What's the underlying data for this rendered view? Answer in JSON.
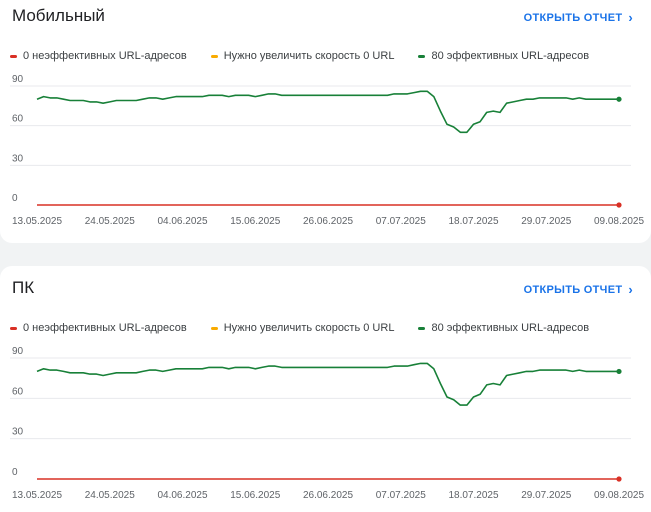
{
  "cards": [
    {
      "title": "Мобильный",
      "open_report": "ОТКРЫТЬ ОТЧЕТ",
      "legend": [
        {
          "label": "0 неэффективных URL-адресов",
          "color": "#d93025"
        },
        {
          "label": "Нужно увеличить скорость 0 URL",
          "color": "#f9ab00"
        },
        {
          "label": "80 эффективных URL-адресов",
          "color": "#188038"
        }
      ]
    },
    {
      "title": "ПК",
      "open_report": "ОТКРЫТЬ ОТЧЕТ",
      "legend": [
        {
          "label": "0 неэффективных URL-адресов",
          "color": "#d93025"
        },
        {
          "label": "Нужно увеличить скорость 0 URL",
          "color": "#f9ab00"
        },
        {
          "label": "80 эффективных URL-адресов",
          "color": "#188038"
        }
      ]
    }
  ],
  "chart_data": [
    {
      "type": "line",
      "title": "Мобильный",
      "xlabel": "",
      "ylabel": "",
      "ylim": [
        0,
        90
      ],
      "yticks": [
        0,
        30,
        60,
        90
      ],
      "x_tick_labels": [
        "13.05.2025",
        "24.05.2025",
        "04.06.2025",
        "15.06.2025",
        "26.06.2025",
        "07.07.2025",
        "18.07.2025",
        "29.07.2025",
        "09.08.2025"
      ],
      "grid": true,
      "series": [
        {
          "name": "0 неэффективных URL-адресов",
          "color": "#d93025",
          "values": [
            0,
            0,
            0,
            0,
            0,
            0,
            0,
            0,
            0,
            0,
            0,
            0,
            0,
            0,
            0,
            0,
            0,
            0,
            0,
            0,
            0,
            0,
            0,
            0,
            0,
            0,
            0,
            0,
            0,
            0,
            0,
            0,
            0,
            0,
            0,
            0,
            0,
            0,
            0,
            0,
            0,
            0,
            0,
            0,
            0,
            0,
            0,
            0,
            0,
            0,
            0,
            0,
            0,
            0,
            0,
            0,
            0,
            0,
            0,
            0,
            0,
            0,
            0,
            0,
            0,
            0,
            0,
            0,
            0,
            0,
            0,
            0,
            0,
            0,
            0,
            0,
            0,
            0,
            0,
            0,
            0,
            0,
            0,
            0,
            0,
            0,
            0,
            0,
            0
          ]
        },
        {
          "name": "80 эффективных URL-адресов",
          "color": "#188038",
          "values": [
            80,
            82,
            81,
            81,
            80,
            79,
            79,
            79,
            78,
            78,
            77,
            78,
            79,
            79,
            79,
            79,
            80,
            81,
            81,
            80,
            81,
            82,
            82,
            82,
            82,
            82,
            83,
            83,
            83,
            82,
            83,
            83,
            83,
            82,
            83,
            84,
            84,
            83,
            83,
            83,
            83,
            83,
            83,
            83,
            83,
            83,
            83,
            83,
            83,
            83,
            83,
            83,
            83,
            83,
            84,
            84,
            84,
            85,
            86,
            86,
            82,
            71,
            61,
            59,
            55,
            55,
            61,
            63,
            70,
            71,
            70,
            77,
            78,
            79,
            80,
            80,
            81,
            81,
            81,
            81,
            81,
            80,
            81,
            80,
            80,
            80,
            80,
            80,
            80
          ]
        }
      ]
    },
    {
      "type": "line",
      "title": "ПК",
      "xlabel": "",
      "ylabel": "",
      "ylim": [
        0,
        90
      ],
      "yticks": [
        0,
        30,
        60,
        90
      ],
      "x_tick_labels": [
        "13.05.2025",
        "24.05.2025",
        "04.06.2025",
        "15.06.2025",
        "26.06.2025",
        "07.07.2025",
        "18.07.2025",
        "29.07.2025",
        "09.08.2025"
      ],
      "grid": true,
      "series": [
        {
          "name": "0 неэффективных URL-адресов",
          "color": "#d93025",
          "values": [
            0,
            0,
            0,
            0,
            0,
            0,
            0,
            0,
            0,
            0,
            0,
            0,
            0,
            0,
            0,
            0,
            0,
            0,
            0,
            0,
            0,
            0,
            0,
            0,
            0,
            0,
            0,
            0,
            0,
            0,
            0,
            0,
            0,
            0,
            0,
            0,
            0,
            0,
            0,
            0,
            0,
            0,
            0,
            0,
            0,
            0,
            0,
            0,
            0,
            0,
            0,
            0,
            0,
            0,
            0,
            0,
            0,
            0,
            0,
            0,
            0,
            0,
            0,
            0,
            0,
            0,
            0,
            0,
            0,
            0,
            0,
            0,
            0,
            0,
            0,
            0,
            0,
            0,
            0,
            0,
            0,
            0,
            0,
            0,
            0,
            0,
            0,
            0,
            0
          ]
        },
        {
          "name": "80 эффективных URL-адресов",
          "color": "#188038",
          "values": [
            80,
            82,
            81,
            81,
            80,
            79,
            79,
            79,
            78,
            78,
            77,
            78,
            79,
            79,
            79,
            79,
            80,
            81,
            81,
            80,
            81,
            82,
            82,
            82,
            82,
            82,
            83,
            83,
            83,
            82,
            83,
            83,
            83,
            82,
            83,
            84,
            84,
            83,
            83,
            83,
            83,
            83,
            83,
            83,
            83,
            83,
            83,
            83,
            83,
            83,
            83,
            83,
            83,
            83,
            84,
            84,
            84,
            85,
            86,
            86,
            82,
            71,
            61,
            59,
            55,
            55,
            61,
            63,
            70,
            71,
            70,
            77,
            78,
            79,
            80,
            80,
            81,
            81,
            81,
            81,
            81,
            80,
            81,
            80,
            80,
            80,
            80,
            80,
            80
          ]
        }
      ]
    }
  ]
}
